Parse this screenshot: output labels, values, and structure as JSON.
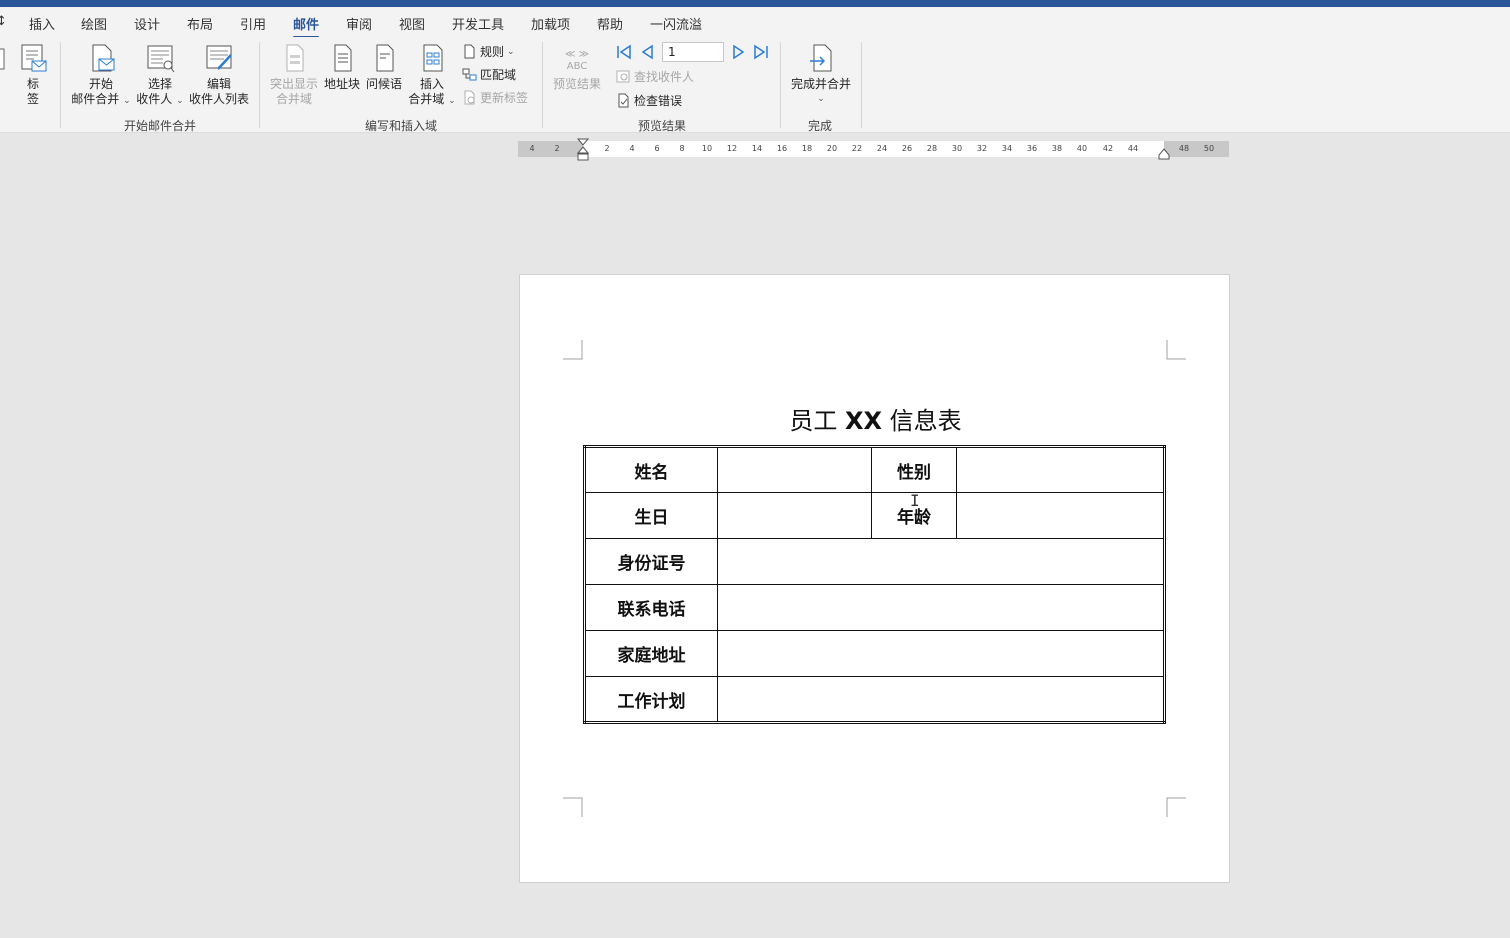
{
  "tabs": {
    "partial": "↕",
    "insert": "插入",
    "draw": "绘图",
    "design": "设计",
    "layout": "布局",
    "references": "引用",
    "mailings": "邮件",
    "review": "审阅",
    "view": "视图",
    "developer": "开发工具",
    "addins": "加载项",
    "help": "帮助",
    "yishan": "一闪流溢"
  },
  "ribbon": {
    "labels_l1": "标",
    "labels_l2": "签",
    "start_merge_l1": "开始",
    "start_merge_l2": "邮件合并",
    "select_recipients_l1": "选择",
    "select_recipients_l2": "收件人",
    "edit_list_l1": "编辑",
    "edit_list_l2": "收件人列表",
    "group_start": "开始邮件合并",
    "highlight_l1": "突出显示",
    "highlight_l2": "合并域",
    "address_block": "地址块",
    "greeting": "问候语",
    "insert_field_l1": "插入",
    "insert_field_l2": "合并域",
    "rules": "规则",
    "match_fields": "匹配域",
    "update_labels": "更新标签",
    "group_write": "编写和插入域",
    "preview_results": "预览结果",
    "abc": "ABC",
    "record_number": "1",
    "find_recipient": "查找收件人",
    "check_errors": "检查错误",
    "group_preview": "预览结果",
    "finish_merge": "完成并合并",
    "group_finish": "完成"
  },
  "ruler": {
    "left_numbers": [
      "4",
      "2"
    ],
    "numbers": [
      "2",
      "4",
      "6",
      "8",
      "10",
      "12",
      "14",
      "16",
      "18",
      "20",
      "22",
      "24",
      "26",
      "28",
      "30",
      "32",
      "34",
      "36",
      "38",
      "40",
      "42",
      "44"
    ],
    "right_numbers": [
      "48",
      "50"
    ]
  },
  "document": {
    "title_a": "员工 ",
    "title_b": "XX",
    "title_c": " 信息表",
    "table": {
      "name": "姓名",
      "gender": "性别",
      "birthday": "生日",
      "age": "年龄",
      "id_number": "身份证号",
      "phone": "联系电话",
      "address": "家庭地址",
      "work_plan": "工作计划"
    }
  }
}
